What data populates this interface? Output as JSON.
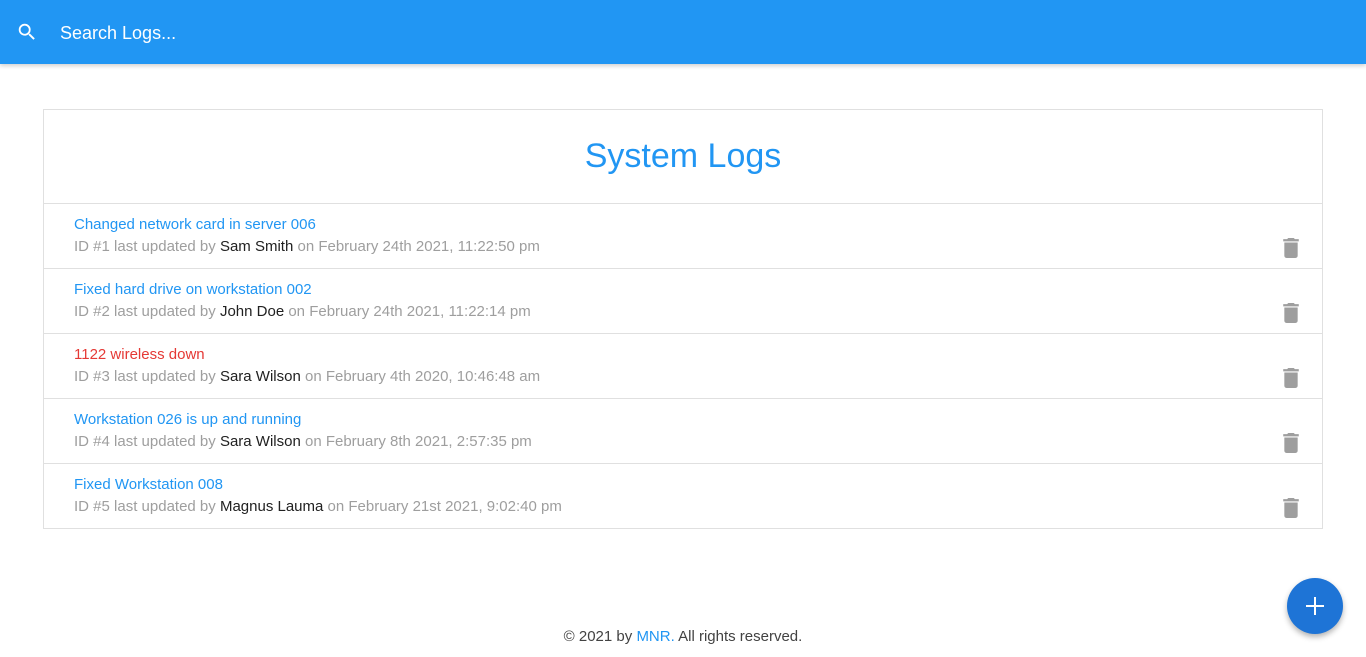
{
  "navbar": {
    "search_placeholder": "Search Logs...",
    "search_value": ""
  },
  "logs_card": {
    "title": "System Logs",
    "items": [
      {
        "message": "Changed network card in server 006",
        "attention": false,
        "id_text": "ID #1",
        "updated_by_label": "last updated by",
        "tech": "Sam Smith",
        "date_text": "on February 24th 2021, 11:22:50 pm"
      },
      {
        "message": "Fixed hard drive on workstation 002",
        "attention": false,
        "id_text": "ID #2",
        "updated_by_label": "last updated by",
        "tech": "John Doe",
        "date_text": "on February 24th 2021, 11:22:14 pm"
      },
      {
        "message": "1122 wireless down",
        "attention": true,
        "id_text": "ID #3",
        "updated_by_label": "last updated by",
        "tech": "Sara Wilson",
        "date_text": "on February 4th 2020, 10:46:48 am"
      },
      {
        "message": "Workstation 026 is up and running",
        "attention": false,
        "id_text": "ID #4",
        "updated_by_label": "last updated by",
        "tech": "Sara Wilson",
        "date_text": "on February 8th 2021, 2:57:35 pm"
      },
      {
        "message": "Fixed Workstation 008",
        "attention": false,
        "id_text": "ID #5",
        "updated_by_label": "last updated by",
        "tech": "Magnus Lauma",
        "date_text": "on February 21st 2021, 9:02:40 pm"
      }
    ]
  },
  "footer": {
    "prefix": "© 2021 by",
    "brand": "MNR.",
    "suffix": "All rights reserved."
  },
  "icons": {
    "search": "search-icon",
    "delete": "trash-icon",
    "add": "plus-icon"
  },
  "colors": {
    "primary": "#2196f3",
    "attention": "#e53935",
    "fab": "#1e74d6",
    "muted": "#9e9e9e"
  }
}
